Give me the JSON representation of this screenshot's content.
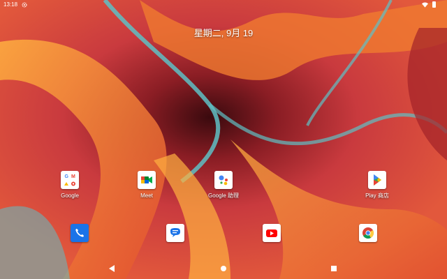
{
  "status_bar": {
    "time": "13:18",
    "icons": [
      "gear-icon",
      "wifi-icon",
      "battery-icon"
    ]
  },
  "date_widget": {
    "text": "星期二, 9月 19"
  },
  "apps": [
    {
      "id": "google",
      "label": "Google",
      "icon": "google-folder-icon"
    },
    {
      "id": "meet",
      "label": "Meet",
      "icon": "meet-icon"
    },
    {
      "id": "assistant",
      "label": "Google 助理",
      "icon": "assistant-icon"
    },
    {
      "id": "play",
      "label": "Play 商店",
      "icon": "play-store-icon"
    }
  ],
  "dock": [
    {
      "id": "phone",
      "icon": "phone-icon"
    },
    {
      "id": "messages",
      "icon": "messages-icon"
    },
    {
      "id": "youtube",
      "icon": "youtube-icon"
    },
    {
      "id": "chrome",
      "icon": "chrome-icon"
    }
  ],
  "nav": [
    "back-icon",
    "home-icon",
    "recents-icon"
  ],
  "colors": {
    "wallpaper_base": "#c23a3e",
    "wallpaper_orange": "#f2922c",
    "wallpaper_dark": "#5a1418",
    "wallpaper_teal": "#5fc0c4"
  }
}
